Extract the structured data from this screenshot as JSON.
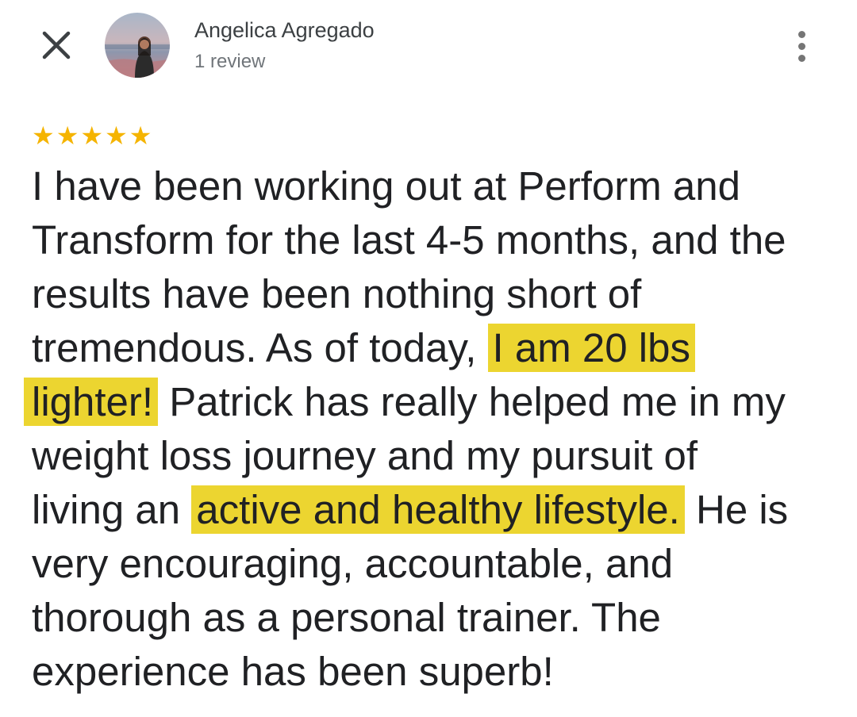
{
  "header": {
    "close_icon": "close-icon",
    "reviewer_name": "Angelica Agregado",
    "review_count": "1 review",
    "more_icon": "more-vert-icon"
  },
  "review": {
    "rating": 5,
    "rating_max": 5,
    "star_color": "#f5b400",
    "highlight_color": "#ecd530",
    "lines": [
      "I have been working out at Perform and",
      "Transform for the last 4-5 months, and the",
      "results have been nothing short of",
      "tremendous. As of today, ",
      "I am 20 lbs ",
      "lighter!",
      " Patrick has really helped me in my",
      "weight loss journey and my pursuit of",
      "living an ",
      "active and healthy lifestyle.",
      " He is",
      "very encouraging, accountable, and",
      "thorough as a personal trainer. The",
      "experience has been superb!"
    ]
  }
}
